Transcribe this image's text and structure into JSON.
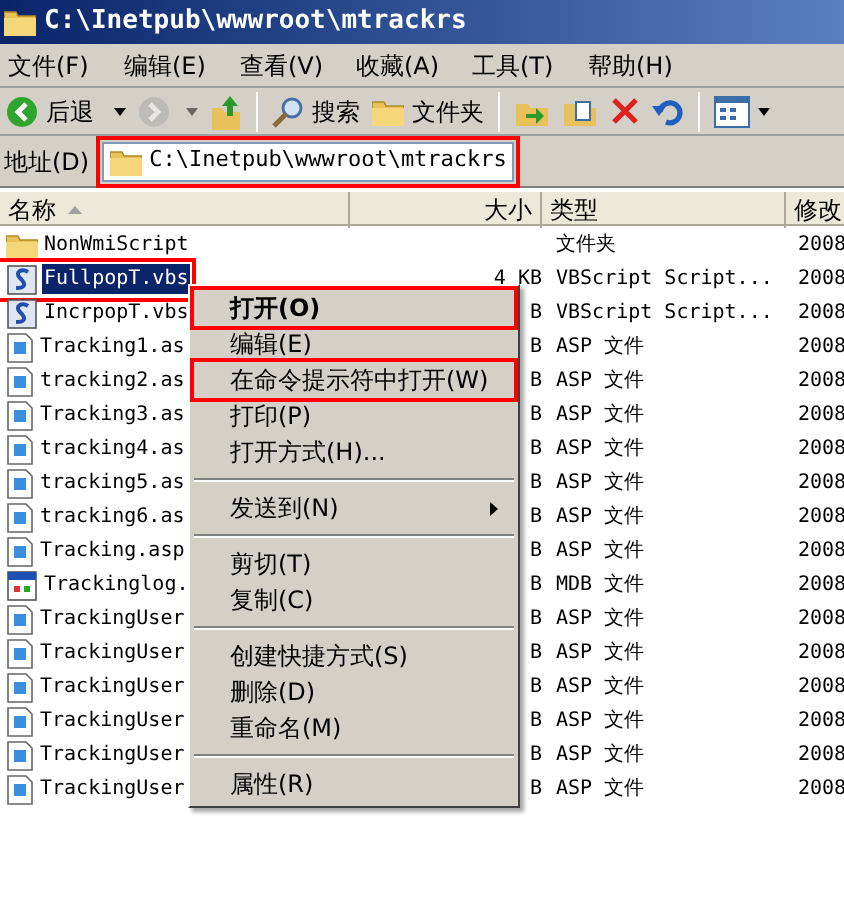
{
  "window": {
    "title": "C:\\Inetpub\\wwwroot\\mtrackrs"
  },
  "menu_bar": [
    {
      "label": "文件(F)"
    },
    {
      "label": "编辑(E)"
    },
    {
      "label": "查看(V)"
    },
    {
      "label": "收藏(A)"
    },
    {
      "label": "工具(T)"
    },
    {
      "label": "帮助(H)"
    }
  ],
  "toolbar": [
    {
      "kind": "back",
      "label": "后退",
      "disabled": false
    },
    {
      "kind": "forward",
      "disabled": true
    },
    {
      "kind": "up",
      "disabled": false
    },
    {
      "kind": "separator"
    },
    {
      "kind": "search",
      "label": "搜索",
      "disabled": false
    },
    {
      "kind": "folders",
      "label": "文件夹",
      "disabled": false
    },
    {
      "kind": "separator"
    },
    {
      "kind": "move",
      "disabled": false
    },
    {
      "kind": "copy",
      "disabled": false
    },
    {
      "kind": "delete",
      "disabled": false
    },
    {
      "kind": "undo",
      "disabled": false
    },
    {
      "kind": "separator"
    },
    {
      "kind": "views",
      "disabled": false
    }
  ],
  "address": {
    "label": "地址(D)",
    "value": "C:\\Inetpub\\wwwroot\\mtrackrs",
    "annotated": true
  },
  "columns": [
    {
      "label": "名称",
      "sorted": true
    },
    {
      "label": "大小",
      "sorted": false
    },
    {
      "label": "类型",
      "sorted": false
    },
    {
      "label": "修改",
      "sorted": false
    }
  ],
  "files": [
    {
      "kind": "folder",
      "name": "NonWmiScript",
      "type": "文件夹",
      "modified": "2008",
      "selected": false,
      "annotated": false
    },
    {
      "kind": "vbs",
      "name": "FullpopT.vbs",
      "size": "4 KB",
      "type": "VBScript Script...",
      "modified": "2008",
      "selected": true,
      "annotated": true
    },
    {
      "kind": "vbs",
      "name": "IncrpopT.vbs",
      "size": "B",
      "type": "VBScript Script...",
      "modified": "2008",
      "selected": false,
      "annotated": false
    },
    {
      "kind": "asp",
      "name": "Tracking1.as",
      "size": "B",
      "type": "ASP 文件",
      "modified": "2008",
      "selected": false,
      "annotated": false
    },
    {
      "kind": "asp",
      "name": "tracking2.as",
      "size": "B",
      "type": "ASP 文件",
      "modified": "2008",
      "selected": false,
      "annotated": false
    },
    {
      "kind": "asp",
      "name": "Tracking3.as",
      "size": "B",
      "type": "ASP 文件",
      "modified": "2008",
      "selected": false,
      "annotated": false
    },
    {
      "kind": "asp",
      "name": "tracking4.as",
      "size": "B",
      "type": "ASP 文件",
      "modified": "2008",
      "selected": false,
      "annotated": false
    },
    {
      "kind": "asp",
      "name": "tracking5.as",
      "size": "B",
      "type": "ASP 文件",
      "modified": "2008",
      "selected": false,
      "annotated": false
    },
    {
      "kind": "asp",
      "name": "tracking6.as",
      "size": "B",
      "type": "ASP 文件",
      "modified": "2008",
      "selected": false,
      "annotated": false
    },
    {
      "kind": "asp",
      "name": "Tracking.asp",
      "size": "B",
      "type": "ASP 文件",
      "modified": "2008",
      "selected": false,
      "annotated": false
    },
    {
      "kind": "mdb",
      "name": "Trackinglog.",
      "size": "B",
      "type": "MDB 文件",
      "modified": "2008",
      "selected": false,
      "annotated": false
    },
    {
      "kind": "asp",
      "name": "TrackingUser",
      "size": "B",
      "type": "ASP 文件",
      "modified": "2008",
      "selected": false,
      "annotated": false
    },
    {
      "kind": "asp",
      "name": "TrackingUser",
      "size": "B",
      "type": "ASP 文件",
      "modified": "2008",
      "selected": false,
      "annotated": false
    },
    {
      "kind": "asp",
      "name": "TrackingUser",
      "size": "B",
      "type": "ASP 文件",
      "modified": "2008",
      "selected": false,
      "annotated": false
    },
    {
      "kind": "asp",
      "name": "TrackingUser",
      "size": "B",
      "type": "ASP 文件",
      "modified": "2008",
      "selected": false,
      "annotated": false
    },
    {
      "kind": "asp",
      "name": "TrackingUser",
      "size": "B",
      "type": "ASP 文件",
      "modified": "2008",
      "selected": false,
      "annotated": false
    },
    {
      "kind": "asp",
      "name": "TrackingUser",
      "size": "B",
      "type": "ASP 文件",
      "modified": "2008",
      "selected": false,
      "annotated": false
    }
  ],
  "context_menu": [
    {
      "kind": "item",
      "label": "打开(O)",
      "default": true,
      "annotated": true
    },
    {
      "kind": "item",
      "label": "编辑(E)",
      "default": false,
      "annotated": false
    },
    {
      "kind": "item",
      "label": "在命令提示符中打开(W)",
      "default": false,
      "annotated": true
    },
    {
      "kind": "item",
      "label": "打印(P)",
      "default": false,
      "annotated": false
    },
    {
      "kind": "item",
      "label": "打开方式(H)...",
      "default": false,
      "annotated": false
    },
    {
      "kind": "separator"
    },
    {
      "kind": "submenu",
      "label": "发送到(N)",
      "default": false,
      "annotated": false
    },
    {
      "kind": "separator"
    },
    {
      "kind": "item",
      "label": "剪切(T)",
      "default": false,
      "annotated": false
    },
    {
      "kind": "item",
      "label": "复制(C)",
      "default": false,
      "annotated": false
    },
    {
      "kind": "separator"
    },
    {
      "kind": "item",
      "label": "创建快捷方式(S)",
      "default": false,
      "annotated": false
    },
    {
      "kind": "item",
      "label": "删除(D)",
      "default": false,
      "annotated": false
    },
    {
      "kind": "item",
      "label": "重命名(M)",
      "default": false,
      "annotated": false
    },
    {
      "kind": "separator"
    },
    {
      "kind": "item",
      "label": "属性(R)",
      "default": false,
      "annotated": false
    }
  ]
}
